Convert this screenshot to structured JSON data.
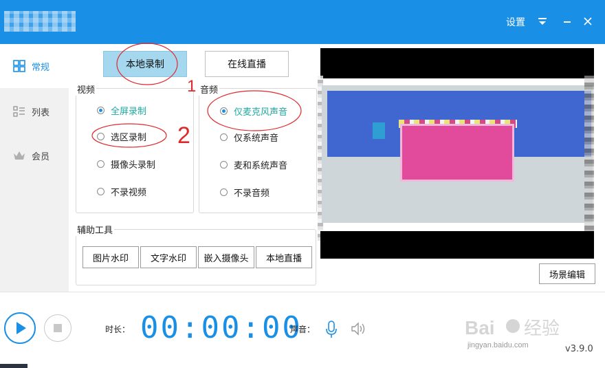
{
  "titlebar": {
    "settings_label": "设置",
    "menu_icon": "menu-icon",
    "minimize_icon": "minimize-icon",
    "close_icon": "close-icon",
    "accent": "#1a8fe6"
  },
  "sidebar": {
    "items": [
      {
        "label": "常规",
        "icon": "grid-icon",
        "active": true
      },
      {
        "label": "列表",
        "icon": "list-icon",
        "active": false
      },
      {
        "label": "会员",
        "icon": "crown-icon",
        "active": false
      }
    ]
  },
  "modes": {
    "local_label": "本地录制",
    "live_label": "在线直播",
    "selected": "local"
  },
  "video": {
    "title": "视频",
    "options": [
      "全屏录制",
      "选区录制",
      "摄像头录制",
      "不录视频"
    ],
    "selected": "全屏录制"
  },
  "audio": {
    "title": "音频",
    "options": [
      "仅麦克风声音",
      "仅系统声音",
      "麦和系统声音",
      "不录音频"
    ],
    "selected": "仅麦克风声音"
  },
  "tools": {
    "title": "辅助工具",
    "buttons": [
      "图片水印",
      "文字水印",
      "嵌入摄像头",
      "本地直播"
    ]
  },
  "scene_edit_label": "场景编辑",
  "bottom": {
    "duration_label": "时长：",
    "timer": "00:00:00",
    "sound_label": "声音：",
    "version": "v3.9.0",
    "mic_icon": "microphone-icon",
    "speaker_icon": "speaker-icon"
  },
  "annotations": {
    "mark_1": "1",
    "mark_2": "2"
  },
  "watermark": {
    "brand": "Bai",
    "brand2": "经验",
    "url": "jingyan.baidu.com"
  }
}
